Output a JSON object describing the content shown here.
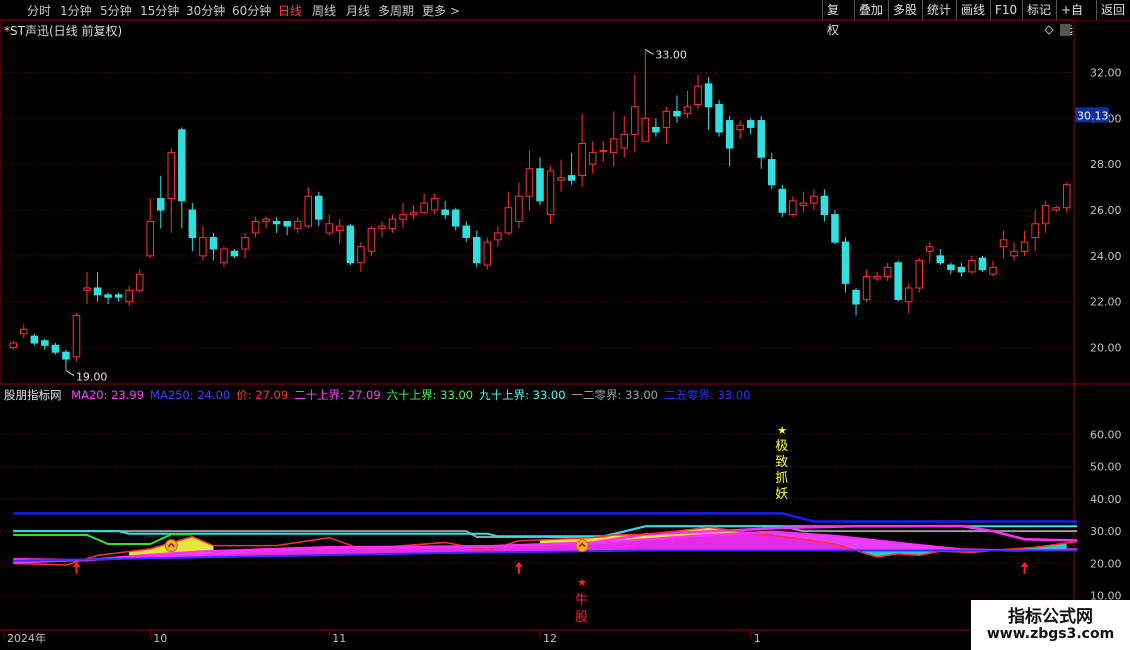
{
  "toolbar": {
    "periods": [
      "分时",
      "1分钟",
      "5分钟",
      "15分钟",
      "30分钟",
      "60分钟",
      "日线",
      "周线",
      "月线",
      "多周期",
      "更多 >"
    ],
    "active_period": "日线",
    "actions": [
      "复权",
      "叠加",
      "多股",
      "统计",
      "画线",
      "F10",
      "标记",
      "+自选",
      "返回"
    ]
  },
  "pane": {
    "title": "*ST声迅(日线 前复权)"
  },
  "indicator": {
    "name": "股朋指标网",
    "items": [
      {
        "label": "MA20: 23.99",
        "color": "#ff40ff"
      },
      {
        "label": "MA250: 24.00",
        "color": "#4040ff"
      },
      {
        "label": "价: 27.09",
        "color": "#ff3030"
      },
      {
        "label": "二十上界: 27.09",
        "color": "#ff40ff"
      },
      {
        "label": "六十上界: 33.00",
        "color": "#40ff40"
      },
      {
        "label": "九十上界: 33.00",
        "color": "#40ffff"
      },
      {
        "label": "一二零界: 33.00",
        "color": "#a0a0a0"
      },
      {
        "label": "二五零界: 33.00",
        "color": "#3030ff"
      }
    ],
    "annotations": {
      "top": "极致抓妖",
      "bottom": "牛股"
    }
  },
  "watermark": {
    "title": "指标公式网",
    "url": "www.zbgs3.com"
  },
  "colors": {
    "up": "#ff3030",
    "down": "#30e0e0",
    "axis": "#8b0000",
    "grid": "#600000"
  },
  "chart_data": [
    {
      "type": "candlestick",
      "title": "*ST声迅(日线 前复权)",
      "ylim": [
        18.5,
        33.5
      ],
      "y_ticks": [
        20,
        22,
        24,
        26,
        28,
        30,
        32
      ],
      "y_tick_labels": [
        "20.00",
        "22.00",
        "24.00",
        "26.00",
        "28.00",
        "30.00",
        "32.00"
      ],
      "last_price": "30.13",
      "high_label": "33.00",
      "low_label": "19.00",
      "x_labels": [
        "2024年",
        "10",
        "11",
        "12",
        "1"
      ],
      "x_label_index": [
        0,
        13,
        30,
        50,
        70
      ],
      "candles": [
        [
          20.0,
          20.2,
          19.9,
          20.3
        ],
        [
          20.6,
          20.8,
          20.4,
          21.0
        ],
        [
          20.5,
          20.2,
          20.1,
          20.6
        ],
        [
          20.3,
          20.1,
          19.9,
          20.4
        ],
        [
          20.1,
          19.8,
          19.7,
          20.2
        ],
        [
          19.8,
          19.5,
          19.0,
          19.9
        ],
        [
          19.6,
          21.4,
          19.4,
          21.5
        ],
        [
          22.5,
          22.6,
          21.9,
          23.3
        ],
        [
          22.6,
          22.3,
          22.0,
          23.3
        ],
        [
          22.3,
          22.2,
          21.9,
          22.4
        ],
        [
          22.3,
          22.2,
          22.0,
          22.4
        ],
        [
          22.0,
          22.5,
          21.8,
          22.7
        ],
        [
          22.5,
          23.2,
          22.4,
          23.4
        ],
        [
          24.0,
          25.5,
          23.9,
          26.5
        ],
        [
          26.5,
          26.0,
          25.2,
          27.5
        ],
        [
          26.5,
          28.5,
          25.0,
          28.7
        ],
        [
          29.5,
          26.4,
          25.2,
          29.6
        ],
        [
          26.0,
          24.8,
          24.2,
          26.3
        ],
        [
          24.0,
          24.8,
          23.8,
          25.3
        ],
        [
          24.8,
          24.3,
          23.8,
          25.0
        ],
        [
          23.7,
          24.3,
          23.5,
          24.4
        ],
        [
          24.2,
          24.0,
          23.9,
          24.3
        ],
        [
          24.3,
          24.8,
          23.9,
          25.0
        ],
        [
          25.0,
          25.5,
          24.8,
          25.7
        ],
        [
          25.5,
          25.6,
          25.2,
          25.7
        ],
        [
          25.5,
          25.4,
          25.0,
          25.7
        ],
        [
          25.5,
          25.3,
          24.9,
          25.5
        ],
        [
          25.2,
          25.5,
          25.0,
          25.7
        ],
        [
          25.3,
          26.6,
          25.2,
          27.0
        ],
        [
          26.6,
          25.6,
          25.3,
          26.8
        ],
        [
          25.0,
          25.4,
          24.9,
          25.8
        ],
        [
          25.1,
          25.3,
          24.5,
          25.6
        ],
        [
          25.3,
          23.7,
          23.6,
          25.4
        ],
        [
          23.7,
          24.4,
          23.3,
          24.6
        ],
        [
          24.2,
          25.2,
          24.0,
          25.3
        ],
        [
          25.2,
          25.3,
          24.8,
          25.5
        ],
        [
          25.2,
          25.6,
          25.0,
          25.8
        ],
        [
          25.6,
          25.8,
          25.2,
          26.3
        ],
        [
          25.8,
          25.9,
          25.6,
          26.2
        ],
        [
          25.9,
          26.3,
          25.8,
          26.7
        ],
        [
          26.0,
          26.5,
          25.8,
          26.7
        ],
        [
          26.0,
          25.8,
          25.6,
          26.4
        ],
        [
          26.0,
          25.3,
          25.1,
          26.1
        ],
        [
          25.3,
          24.8,
          24.6,
          25.5
        ],
        [
          24.8,
          23.7,
          23.5,
          25.1
        ],
        [
          23.6,
          24.6,
          23.4,
          24.8
        ],
        [
          24.7,
          25.0,
          24.4,
          25.3
        ],
        [
          25.0,
          26.1,
          24.9,
          26.8
        ],
        [
          25.5,
          26.6,
          25.2,
          27.2
        ],
        [
          26.6,
          27.8,
          26.0,
          28.6
        ],
        [
          27.8,
          26.4,
          26.2,
          28.3
        ],
        [
          25.8,
          27.7,
          25.4,
          27.9
        ],
        [
          27.3,
          27.4,
          26.8,
          28.2
        ],
        [
          27.5,
          27.3,
          27.1,
          28.5
        ],
        [
          27.5,
          28.9,
          27.0,
          30.2
        ],
        [
          28.0,
          28.5,
          27.6,
          29.0
        ],
        [
          28.6,
          28.6,
          28.1,
          29.0
        ],
        [
          28.5,
          29.1,
          27.9,
          30.3
        ],
        [
          28.7,
          29.3,
          28.3,
          30.1
        ],
        [
          29.3,
          30.5,
          28.5,
          31.9
        ],
        [
          29.0,
          30.0,
          29.0,
          33.0
        ],
        [
          29.6,
          29.4,
          29.2,
          30.0
        ],
        [
          29.6,
          30.3,
          28.9,
          30.5
        ],
        [
          30.3,
          30.1,
          29.8,
          31.0
        ],
        [
          30.2,
          30.5,
          30.0,
          31.2
        ],
        [
          30.6,
          31.4,
          30.4,
          31.9
        ],
        [
          31.5,
          30.5,
          29.5,
          31.8
        ],
        [
          30.6,
          29.4,
          29.2,
          30.8
        ],
        [
          29.9,
          28.7,
          27.9,
          30.1
        ],
        [
          29.5,
          29.7,
          29.1,
          29.9
        ],
        [
          29.9,
          29.6,
          29.3,
          30.0
        ],
        [
          29.9,
          28.3,
          27.8,
          30.1
        ],
        [
          28.2,
          27.1,
          26.9,
          28.5
        ],
        [
          26.9,
          25.9,
          25.7,
          27.1
        ],
        [
          25.8,
          26.4,
          25.7,
          26.6
        ],
        [
          26.2,
          26.3,
          25.9,
          26.8
        ],
        [
          26.3,
          26.6,
          26.0,
          26.9
        ],
        [
          26.6,
          25.8,
          25.5,
          26.9
        ],
        [
          25.8,
          24.6,
          24.5,
          26.0
        ],
        [
          24.6,
          22.8,
          22.4,
          24.8
        ],
        [
          22.5,
          21.9,
          21.4,
          22.6
        ],
        [
          22.1,
          23.1,
          22.0,
          23.4
        ],
        [
          23.0,
          23.1,
          22.9,
          23.3
        ],
        [
          23.1,
          23.5,
          22.9,
          23.7
        ],
        [
          23.7,
          22.1,
          22.0,
          23.8
        ],
        [
          22.0,
          22.6,
          21.5,
          22.8
        ],
        [
          22.6,
          23.8,
          22.4,
          23.9
        ],
        [
          24.2,
          24.4,
          23.7,
          24.6
        ],
        [
          24.0,
          23.7,
          23.6,
          24.3
        ],
        [
          23.6,
          23.4,
          23.2,
          23.7
        ],
        [
          23.5,
          23.3,
          23.1,
          23.7
        ],
        [
          23.3,
          23.8,
          23.2,
          24.0
        ],
        [
          23.9,
          23.4,
          23.3,
          24.0
        ],
        [
          23.2,
          23.5,
          23.1,
          23.8
        ],
        [
          24.4,
          24.7,
          23.9,
          25.1
        ],
        [
          24.0,
          24.2,
          23.8,
          24.6
        ],
        [
          24.2,
          24.6,
          24.0,
          25.1
        ],
        [
          24.8,
          25.4,
          24.2,
          26.0
        ],
        [
          25.4,
          26.2,
          25.0,
          26.4
        ],
        [
          26.0,
          26.1,
          25.9,
          26.2
        ],
        [
          26.1,
          27.1,
          25.9,
          27.2
        ]
      ]
    },
    {
      "type": "line",
      "title": "股朋指标网",
      "ylim": [
        0,
        70
      ],
      "y_ticks": [
        10,
        20,
        30,
        40,
        50,
        60
      ],
      "y_tick_labels": [
        "10.00",
        "20.00",
        "30.00",
        "40.00",
        "50.00",
        "60.00"
      ],
      "series": [
        {
          "name": "二五零界",
          "color": "#1a1aff",
          "points": [
            [
              0,
              35.5
            ],
            [
              73,
              35.5
            ],
            [
              76,
              33.0
            ],
            [
              101,
              33.0
            ]
          ]
        },
        {
          "name": "一二零界",
          "color": "#9a9a9a",
          "points": [
            [
              0,
              30.0
            ],
            [
              43,
              30.0
            ],
            [
              44,
              28.2
            ],
            [
              56,
              28.2
            ],
            [
              60,
              31.5
            ],
            [
              73,
              31.5
            ],
            [
              75,
              30.0
            ],
            [
              101,
              30.0
            ]
          ]
        },
        {
          "name": "九十上界",
          "color": "#30e0e0",
          "points": [
            [
              0,
              30.0
            ],
            [
              10,
              30.0
            ],
            [
              11,
              29.2
            ],
            [
              45,
              29.2
            ],
            [
              46,
              28.4
            ],
            [
              56,
              28.4
            ],
            [
              60,
              31.5
            ],
            [
              101,
              31.5
            ]
          ]
        },
        {
          "name": "六十上界",
          "color": "#30e030",
          "points": [
            [
              0,
              28.8
            ],
            [
              7,
              28.8
            ],
            [
              9,
              26.0
            ],
            [
              13,
              26.0
            ],
            [
              15,
              29.0
            ],
            [
              17,
              29.0
            ]
          ]
        },
        {
          "name": "二十上界",
          "color": "#ff30ff",
          "points": [
            [
              0,
              21.3
            ],
            [
              7,
              21.0
            ],
            [
              12,
              22.4
            ],
            [
              18,
              23.7
            ],
            [
              30,
              25.0
            ],
            [
              45,
              25.3
            ],
            [
              55,
              26.5
            ],
            [
              60,
              29.0
            ],
            [
              73,
              31.0
            ],
            [
              80,
              31.5
            ],
            [
              90,
              31.6
            ],
            [
              93,
              30.0
            ],
            [
              96,
              27.5
            ],
            [
              101,
              27.1
            ]
          ]
        },
        {
          "name": "价",
          "color": "#ff3030",
          "points": [
            [
              0,
              20.0
            ],
            [
              5,
              19.5
            ],
            [
              8,
              22.5
            ],
            [
              13,
              24.5
            ],
            [
              17,
              28.3
            ],
            [
              19,
              25.5
            ],
            [
              25,
              25.5
            ],
            [
              30,
              28.0
            ],
            [
              33,
              24.5
            ],
            [
              41,
              26.5
            ],
            [
              45,
              24.0
            ],
            [
              48,
              27.0
            ],
            [
              55,
              28.0
            ],
            [
              57,
              28.8
            ],
            [
              60,
              29.0
            ],
            [
              63,
              30.0
            ],
            [
              66,
              31.2
            ],
            [
              70,
              29.5
            ],
            [
              75,
              27.5
            ],
            [
              78,
              26.0
            ],
            [
              80,
              24.0
            ],
            [
              82,
              22.0
            ],
            [
              84,
              23.0
            ],
            [
              86,
              22.5
            ],
            [
              88,
              23.8
            ],
            [
              91,
              23.4
            ],
            [
              94,
              24.3
            ],
            [
              97,
              25.0
            ],
            [
              101,
              26.8
            ]
          ]
        },
        {
          "name": "MA20",
          "color": "#ff30ff",
          "points": [
            [
              0,
              20.3
            ],
            [
              12,
              21.8
            ],
            [
              20,
              23.2
            ],
            [
              30,
              24.8
            ],
            [
              45,
              25.3
            ],
            [
              55,
              26.2
            ],
            [
              65,
              28.6
            ],
            [
              72,
              29.8
            ],
            [
              78,
              28.5
            ],
            [
              85,
              26.0
            ],
            [
              90,
              24.3
            ],
            [
              95,
              24.0
            ],
            [
              101,
              24.3
            ]
          ]
        },
        {
          "name": "MA250",
          "color": "#3030ff",
          "points": [
            [
              0,
              20.8
            ],
            [
              20,
              22.0
            ],
            [
              40,
              23.2
            ],
            [
              60,
              24.0
            ],
            [
              80,
              24.0
            ],
            [
              101,
              24.0
            ]
          ]
        }
      ],
      "signals_up_arrow_index": [
        6,
        48,
        96
      ],
      "signals_circle_index": [
        15,
        54
      ]
    }
  ]
}
